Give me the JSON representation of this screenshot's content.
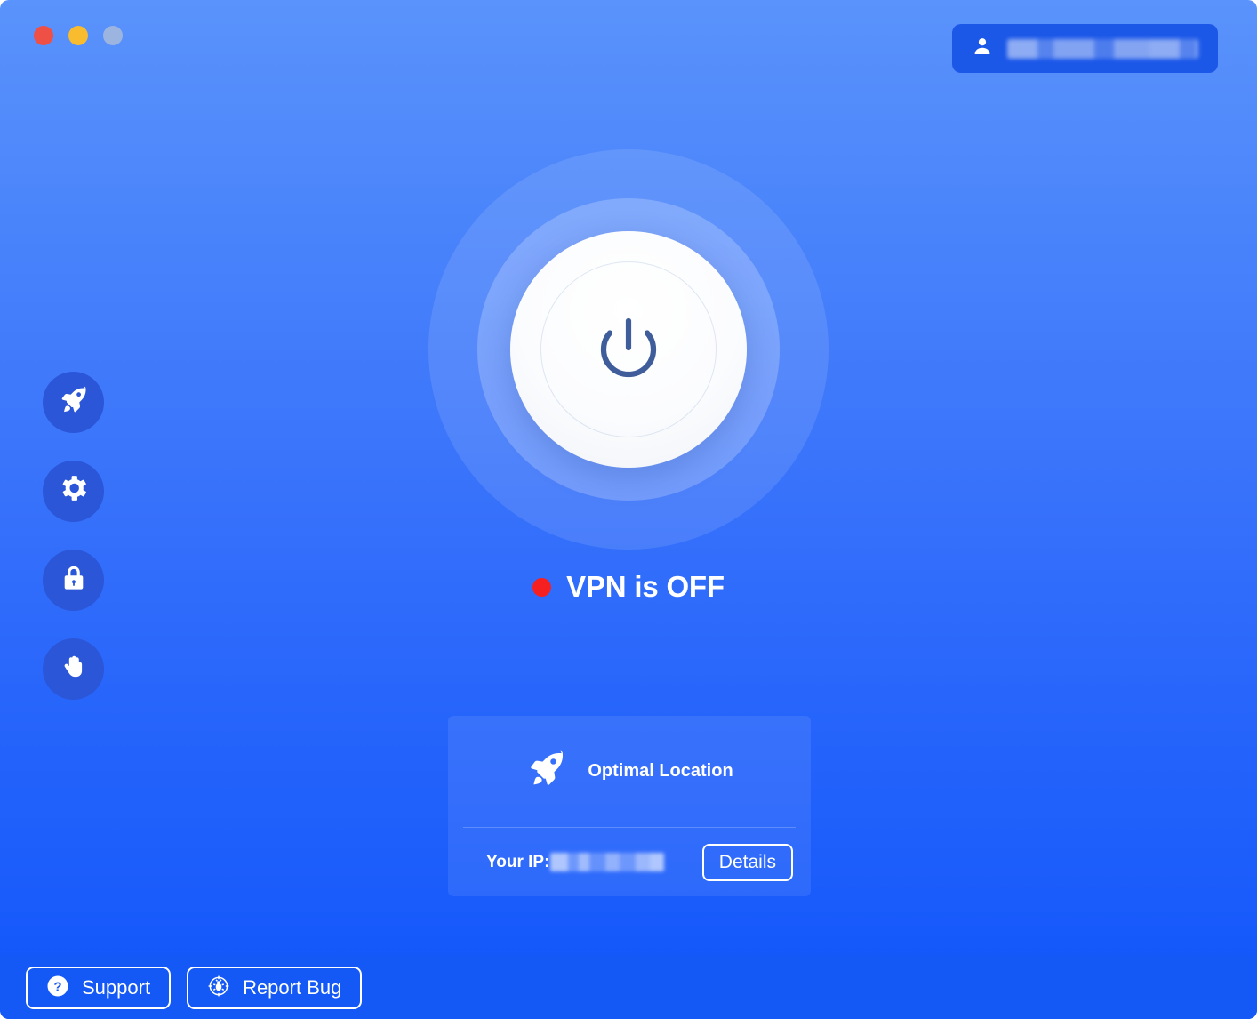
{
  "window": {
    "traffic_lights": [
      {
        "name": "close",
        "color": "#ee5045"
      },
      {
        "name": "minimize",
        "color": "#f8bc2e"
      },
      {
        "name": "maximize",
        "color": "#9bb4e0"
      }
    ]
  },
  "account": {
    "icon": "user-icon",
    "name_redacted": ""
  },
  "sidebar": {
    "items": [
      {
        "icon": "rocket-icon",
        "name": "optimal-location"
      },
      {
        "icon": "gear-icon",
        "name": "settings"
      },
      {
        "icon": "lock-icon",
        "name": "security"
      },
      {
        "icon": "hand-icon",
        "name": "block"
      }
    ]
  },
  "power": {
    "icon": "power-icon",
    "is_on": false
  },
  "status": {
    "text": "VPN is OFF",
    "dot_color": "#f72020"
  },
  "location_card": {
    "icon": "rocket-icon",
    "label": "Optimal Location",
    "ip_label": "Your IP:",
    "ip_value_redacted": "",
    "details_label": "Details"
  },
  "footer": {
    "support_label": "Support",
    "support_icon": "help-circle-icon",
    "report_bug_label": "Report Bug",
    "report_bug_icon": "bug-target-icon"
  },
  "colors": {
    "bg_top": "#5a93fb",
    "bg_bottom": "#0f54fa",
    "footer": "#1458f6",
    "sidebar_circle": "#2b56d8",
    "account_badge": "#1c58e8",
    "accent_white": "#ffffff",
    "power_glyph": "#3f5c9b"
  }
}
